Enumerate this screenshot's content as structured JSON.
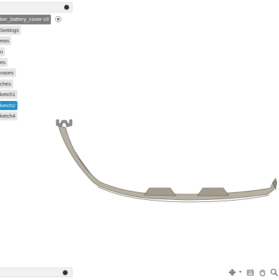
{
  "browser": {
    "root_component": "ker_battery_cover v3",
    "items": [
      {
        "label": "Settings",
        "selected": false
      },
      {
        "label": "ews",
        "selected": false
      },
      {
        "label": "n",
        "selected": false
      },
      {
        "label": "es",
        "selected": false
      },
      {
        "label": "vases",
        "selected": false
      },
      {
        "label": "ches",
        "selected": false
      },
      {
        "label": "ketch1",
        "selected": false
      },
      {
        "label": "ketch2",
        "selected": true
      },
      {
        "label": "ketch4",
        "selected": false
      }
    ]
  },
  "colors": {
    "selected": "#1a8ec9",
    "model_fill": "#b8b0a2",
    "model_dark": "#6f6a62"
  },
  "navbar": {
    "icons": [
      "orbit-icon",
      "caret-down-icon",
      "fit-view-icon",
      "pan-hand-icon",
      "zoom-icon"
    ]
  }
}
